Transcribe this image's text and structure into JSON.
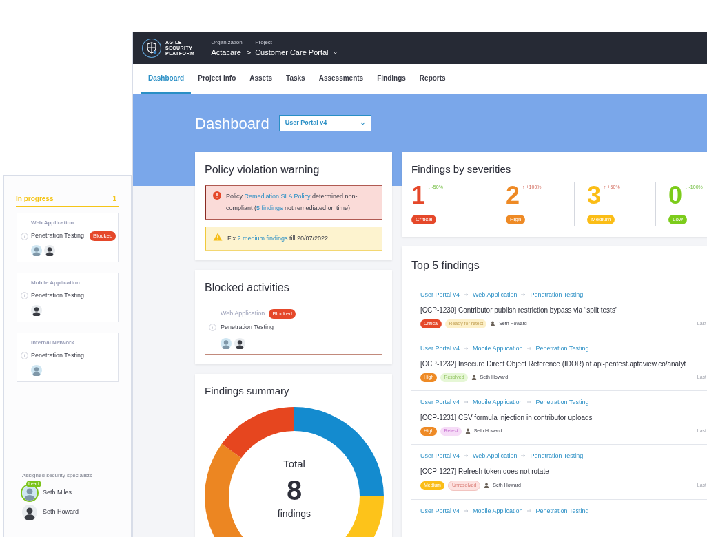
{
  "side_panel": {
    "column": {
      "title": "In progress",
      "count": "1"
    },
    "cards": [
      {
        "asset": "Web Application",
        "activity": "Penetration Testing",
        "badge": "Blocked",
        "avatars": [
          {
            "kind": "light"
          },
          {
            "kind": "dark"
          }
        ]
      },
      {
        "asset": "Mobile Application",
        "activity": "Penetration Testing",
        "avatars": [
          {
            "kind": "dark"
          }
        ]
      },
      {
        "asset": "Internal Network",
        "activity": "Penetration Testing",
        "avatars": [
          {
            "kind": "light"
          }
        ]
      }
    ],
    "specialists": {
      "title": "Assigned security specialists",
      "people": [
        {
          "name": "Seth Miles",
          "badge": "Lead",
          "kind": "light"
        },
        {
          "name": "Seth Howard",
          "kind": "dark"
        }
      ]
    }
  },
  "header": {
    "logo_lines": [
      "AGILE",
      "SECURITY",
      "PLATFORM"
    ],
    "organization_label": "Organization",
    "organization": "Actacare",
    "separator": ">",
    "project_label": "Project",
    "project": "Customer Care Portal"
  },
  "tabs": [
    {
      "label": "Dashboard",
      "selected": true
    },
    {
      "label": "Project info",
      "selected": false
    },
    {
      "label": "Assets",
      "selected": false
    },
    {
      "label": "Tasks",
      "selected": false
    },
    {
      "label": "Assessments",
      "selected": false
    },
    {
      "label": "Findings",
      "selected": false
    },
    {
      "label": "Reports",
      "selected": false
    }
  ],
  "dashboard": {
    "title": "Dashboard",
    "select_value": "User Portal v4"
  },
  "policy": {
    "title": "Policy violation warning",
    "alerts": [
      {
        "kind": "error",
        "parts": [
          {
            "text": "Policy ",
            "link": false
          },
          {
            "text": "Remediation SLA Policy",
            "link": true
          },
          {
            "text": " determined non-compliant (",
            "link": false
          },
          {
            "text": "5 findings",
            "link": true
          },
          {
            "text": " not remediated on time)",
            "link": false
          }
        ]
      },
      {
        "kind": "warning",
        "parts": [
          {
            "text": "Fix ",
            "link": false
          },
          {
            "text": "2 medium findings",
            "link": true
          },
          {
            "text": " till 20/07/2022",
            "link": false
          }
        ]
      }
    ]
  },
  "blocked": {
    "title": "Blocked activities",
    "items": [
      {
        "asset": "Web Application",
        "badge": "Blocked",
        "activity": "Penetration Testing",
        "avatars": [
          {
            "kind": "light"
          },
          {
            "kind": "dark"
          }
        ]
      }
    ]
  },
  "summary": {
    "title": "Findings summary",
    "center_label": "Total",
    "total": "8",
    "unit": "findings"
  },
  "severities": {
    "title": "Findings by severities",
    "items": [
      {
        "count": "1",
        "kind": "down",
        "arrow": "↓",
        "change": "-50%",
        "label": "Critical",
        "color": "#e5482a"
      },
      {
        "count": "2",
        "kind": "up",
        "arrow": "↑",
        "change": "+100%",
        "label": "High",
        "color": "#ee8a25"
      },
      {
        "count": "3",
        "kind": "up",
        "arrow": "↑",
        "change": "+50%",
        "label": "Medium",
        "color": "#fbbd16"
      },
      {
        "count": "0",
        "kind": "down",
        "arrow": "↓",
        "change": "-100%",
        "label": "Low",
        "color": "#7ccc1b"
      }
    ]
  },
  "top_findings": {
    "title": "Top 5 findings",
    "items": [
      {
        "path": [
          "User Portal v4",
          "Web Application",
          "Penetration Testing"
        ],
        "title": "[CCP-1230] Contributor publish restriction bypass via “split tests”",
        "severity": "Critical",
        "color": "#e5482a",
        "status": {
          "text": "Ready for retest",
          "kind": "ready"
        },
        "assignee": "Seth Howard",
        "last": "Last"
      },
      {
        "path": [
          "User Portal v4",
          "Mobile Application",
          "Penetration Testing"
        ],
        "title": "[CCP-1232] Insecure Direct Object Reference (IDOR) at api-pentest.aptaview.co/analyt",
        "severity": "High",
        "color": "#ee8a25",
        "status": {
          "text": "Resolved",
          "kind": "resolved"
        },
        "assignee": "Seth Howard",
        "last": "Last"
      },
      {
        "path": [
          "User Portal v4",
          "Mobile Application",
          "Penetration Testing"
        ],
        "title": "[CCP-1231] CSV formula injection in contributor uploads",
        "severity": "High",
        "color": "#ee8a25",
        "status": {
          "text": "Retest",
          "kind": "retest"
        },
        "assignee": "Seth Howard",
        "last": "Last"
      },
      {
        "path": [
          "User Portal v4",
          "Web Application",
          "Penetration Testing"
        ],
        "title": "[CCP-1227] Refresh token does not rotate",
        "severity": "Medium",
        "color": "#fbbd16",
        "status": {
          "text": "Unresolved",
          "kind": "unresolved"
        },
        "assignee": "Seth Howard",
        "last": "Last"
      },
      {
        "path": [
          "User Portal v4",
          "Mobile Application",
          "Penetration Testing"
        ]
      }
    ]
  }
}
